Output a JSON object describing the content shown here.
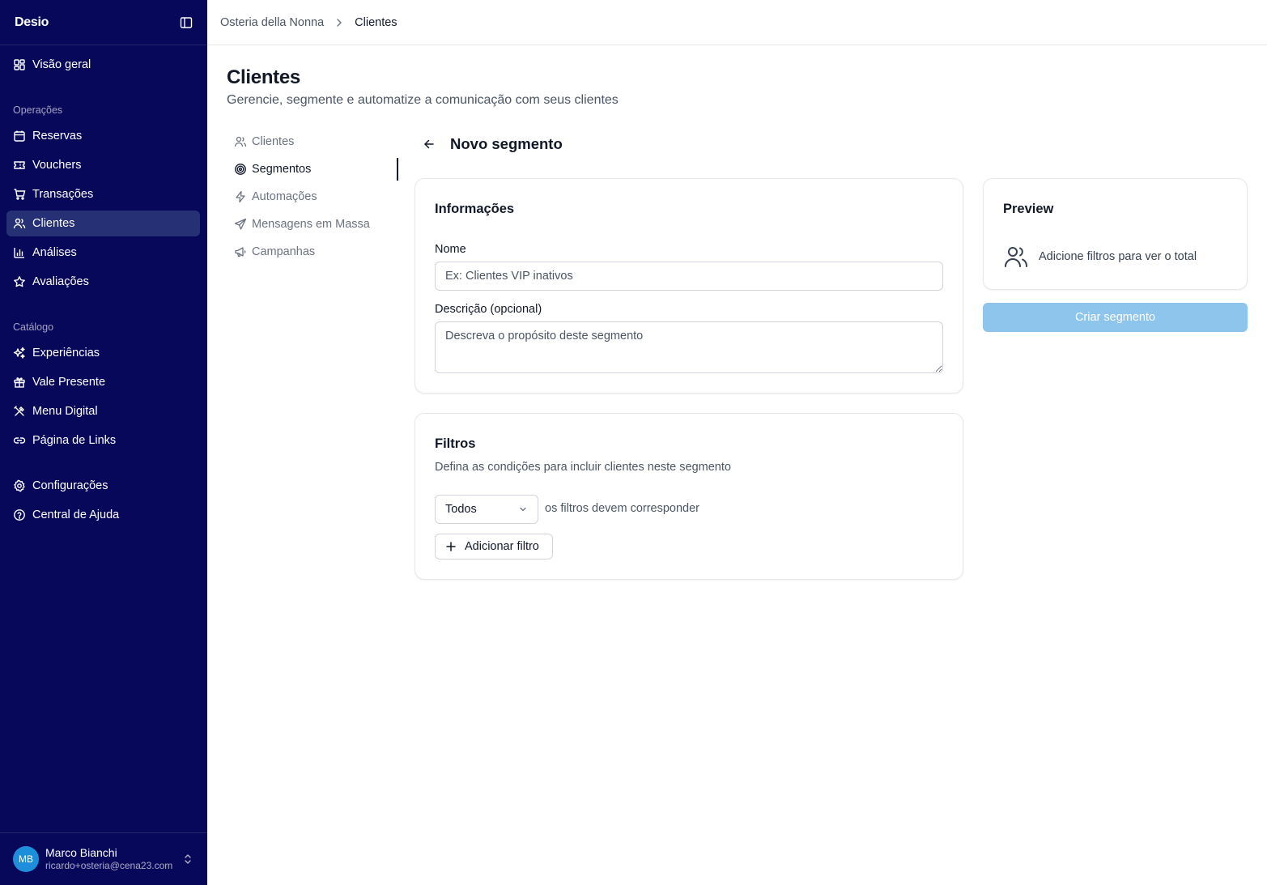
{
  "app": {
    "logo": "Desio"
  },
  "sidebar": {
    "overview": "Visão geral",
    "sections": {
      "operations": "Operações",
      "catalog": "Catálogo"
    },
    "operations": [
      "Reservas",
      "Vouchers",
      "Transações",
      "Clientes",
      "Análises",
      "Avaliações"
    ],
    "catalog": [
      "Experiências",
      "Vale Presente",
      "Menu Digital",
      "Página de Links"
    ],
    "footer_items": [
      "Configurações",
      "Central de Ajuda"
    ],
    "active": "Clientes",
    "user": {
      "initials": "MB",
      "name": "Marco Bianchi",
      "email": "ricardo+osteria@cena23.com"
    }
  },
  "breadcrumb": {
    "parent": "Osteria della Nonna",
    "current": "Clientes"
  },
  "header": {
    "title": "Clientes",
    "subtitle": "Gerencie, segmente e automatize a comunicação com seus clientes"
  },
  "subnav": {
    "items": [
      "Clientes",
      "Segmentos",
      "Automações",
      "Mensagens em Massa",
      "Campanhas"
    ],
    "active": "Segmentos"
  },
  "section": {
    "title": "Novo segmento"
  },
  "info_card": {
    "title": "Informações",
    "name_label": "Nome",
    "name_placeholder": "Ex: Clientes VIP inativos",
    "description_label": "Descrição (opcional)",
    "description_placeholder": "Descreva o propósito deste segmento"
  },
  "filters_card": {
    "title": "Filtros",
    "description": "Defina as condições para incluir clientes neste segmento",
    "match_value": "Todos",
    "match_suffix": "os filtros devem corresponder",
    "add_filter_label": "Adicionar filtro"
  },
  "preview_card": {
    "title": "Preview",
    "empty_text": "Adicione filtros para ver o total"
  },
  "actions": {
    "create_label": "Criar segmento"
  },
  "colors": {
    "sidebar_bg": "#08085a",
    "active_item_bg": "#253075",
    "primary_disabled": "#8ec5ec",
    "avatar": "#1d8ed9"
  }
}
